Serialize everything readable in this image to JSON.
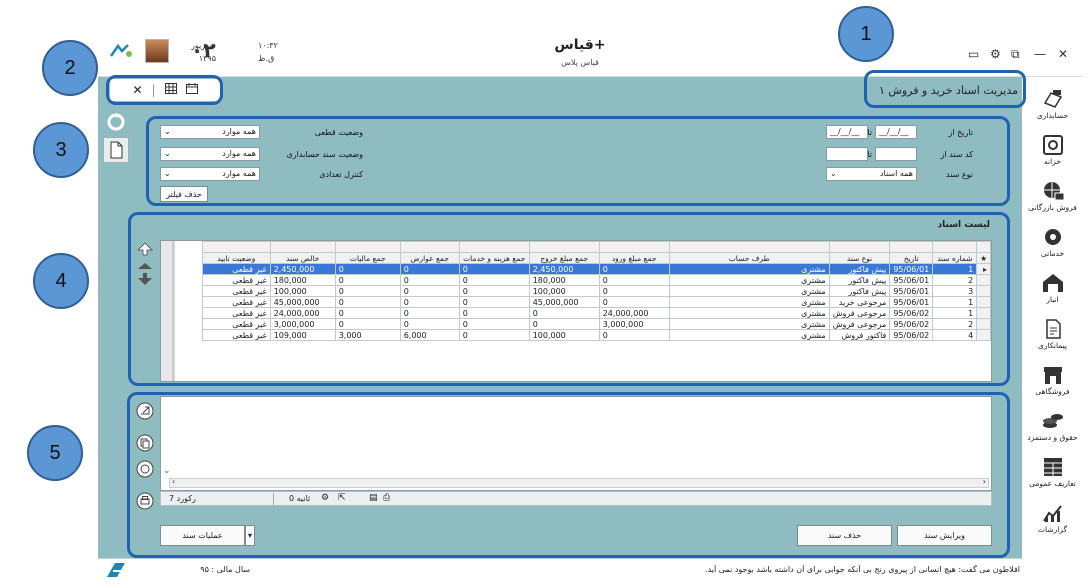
{
  "header": {
    "app_title": "قیاس+",
    "app_subtitle": "قیاس پلاس",
    "day_number": "۰۲",
    "month": "شهریور",
    "year": "۱۳۹۵",
    "time": "۱۰:۳۲",
    "ampm": "ق.ظ",
    "window_controls": [
      "✕",
      "—",
      "⧉",
      "⚙",
      "▭"
    ]
  },
  "document": {
    "title": "مدیریت اسناد خرید و فروش ۱"
  },
  "toolbar2": {
    "close_glyph": "✕",
    "sep": "|"
  },
  "filters": {
    "date_from_label": "تاریخ از",
    "date_from_value": "__/__/__",
    "to_label": "تا",
    "date_to_value": "__/__/__",
    "code_from_label": "کد سند از",
    "code_to_label": "تا",
    "doc_type_label": "نوع سند",
    "doc_type_value": "همه اسناد",
    "final_status_label": "وضعیت قطعی",
    "final_status_value": "همه موارد",
    "acc_status_label": "وضعیت سند حسابداری",
    "acc_status_value": "همه موارد",
    "count_control_label": "کنترل تعدادی",
    "count_control_value": "همه موارد",
    "clear_button": "حذف فیلتر"
  },
  "list": {
    "title": "لیست اسناد",
    "columns": [
      "شماره سند",
      "تاریخ",
      "نوع سند",
      "طرف حساب",
      "جمع مبلغ ورود",
      "جمع مبلغ خروج",
      "جمع هزینه و خدمات",
      "جمع عوارض",
      "جمع مالیات",
      "خالص سند",
      "وضعیت تایید"
    ],
    "rows": [
      [
        "1",
        "95/06/01",
        "پیش فاکتور",
        "مشتری",
        "0",
        "2,450,000",
        "0",
        "0",
        "0",
        "2,450,000",
        "غیر قطعی"
      ],
      [
        "2",
        "95/06/01",
        "پیش فاکتور",
        "مشتری",
        "0",
        "180,000",
        "0",
        "0",
        "0",
        "180,000",
        "غیر قطعی"
      ],
      [
        "3",
        "95/06/01",
        "پیش فاکتور",
        "مشتری",
        "0",
        "100,000",
        "0",
        "0",
        "0",
        "100,000",
        "غیر قطعی"
      ],
      [
        "1",
        "95/06/01",
        "مرجوعی خرید",
        "مشتری",
        "0",
        "45,000,000",
        "0",
        "0",
        "0",
        "45,000,000",
        "غیر قطعی"
      ],
      [
        "1",
        "95/06/02",
        "مرجوعی فروش",
        "مشتری",
        "24,000,000",
        "0",
        "0",
        "0",
        "0",
        "24,000,000",
        "غیر قطعی"
      ],
      [
        "2",
        "95/06/02",
        "مرجوعی فروش",
        "مشتری",
        "3,000,000",
        "0",
        "0",
        "0",
        "0",
        "3,000,000",
        "غیر قطعی"
      ],
      [
        "4",
        "95/06/02",
        "فاکتور فروش",
        "مشتری",
        "0",
        "100,000",
        "0",
        "6,000",
        "3,000",
        "109,000",
        "غیر قطعی"
      ]
    ]
  },
  "preview_bar": {
    "records": "7 رکورد",
    "seconds": "0 ثانیه"
  },
  "actions": {
    "edit_button": "ویرایش سند",
    "delete_button": "حذف سند",
    "operations_button": "عملیات سند"
  },
  "nav": [
    {
      "label": "حسابداری",
      "icon": "accounting-icon"
    },
    {
      "label": "خزانه",
      "icon": "treasury-icon"
    },
    {
      "label": "فروش بازرگانی",
      "icon": "commerce-icon"
    },
    {
      "label": "خدماتی",
      "icon": "services-icon"
    },
    {
      "label": "انبار",
      "icon": "warehouse-icon"
    },
    {
      "label": "پیمانکاری",
      "icon": "contracting-icon"
    },
    {
      "label": "فروشگاهی",
      "icon": "store-icon"
    },
    {
      "label": "حقوق و دستمزد",
      "icon": "payroll-icon"
    },
    {
      "label": "تعاریف عمومی",
      "icon": "definitions-icon"
    },
    {
      "label": "گزارشات",
      "icon": "reports-icon"
    }
  ],
  "status": {
    "fiscal_year": "سال مالی : ۹۵",
    "quote": "افلاطون می گفت: هیچ انسانی از پیروی رنج بی آنکه جوابی برای آن داشته باشد بوجود نمی آید."
  },
  "callouts": [
    "1",
    "2",
    "3",
    "4",
    "5"
  ],
  "colors": {
    "panel": "#8fbcc1",
    "highlight_border": "#1f63b5",
    "callout_fill": "#5b97d5",
    "selected_row": "#3a78d8"
  }
}
